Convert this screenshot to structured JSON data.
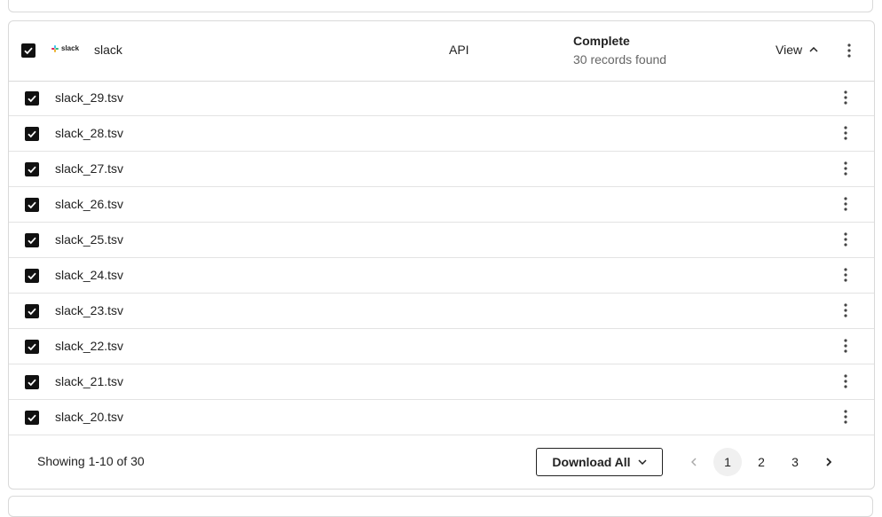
{
  "source": {
    "logo_text": "slack",
    "name": "slack",
    "type": "API",
    "status": "Complete",
    "status_detail": "30 records found",
    "view_label": "View",
    "checked": true
  },
  "files": [
    {
      "name": "slack_29.tsv",
      "checked": true
    },
    {
      "name": "slack_28.tsv",
      "checked": true
    },
    {
      "name": "slack_27.tsv",
      "checked": true
    },
    {
      "name": "slack_26.tsv",
      "checked": true
    },
    {
      "name": "slack_25.tsv",
      "checked": true
    },
    {
      "name": "slack_24.tsv",
      "checked": true
    },
    {
      "name": "slack_23.tsv",
      "checked": true
    },
    {
      "name": "slack_22.tsv",
      "checked": true
    },
    {
      "name": "slack_21.tsv",
      "checked": true
    },
    {
      "name": "slack_20.tsv",
      "checked": true
    }
  ],
  "footer": {
    "showing": "Showing 1-10 of 30",
    "download_label": "Download All",
    "pages": [
      "1",
      "2",
      "3"
    ],
    "current_page": "1"
  },
  "icons": {
    "checkbox": "checkbox-checked-icon",
    "kebab": "more-vertical-icon",
    "view_toggle": "chevron-up-icon",
    "download_dropdown": "chevron-down-icon",
    "prev": "chevron-left-icon",
    "next": "chevron-right-icon"
  }
}
